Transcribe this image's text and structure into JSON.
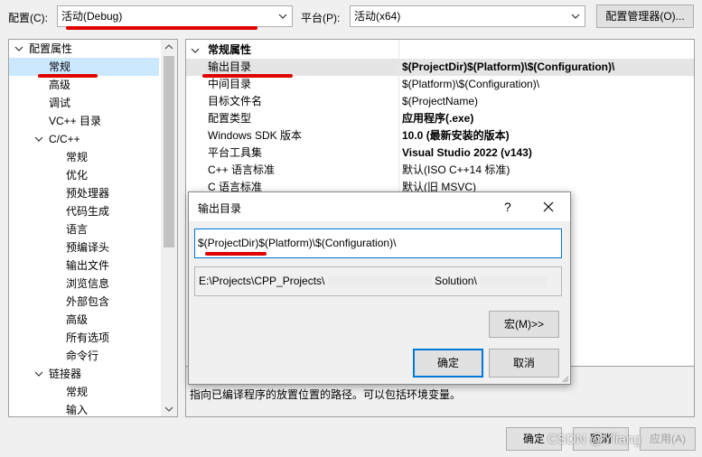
{
  "toolbar": {
    "config_label": "配置(C):",
    "config_value": "活动(Debug)",
    "platform_label": "平台(P):",
    "platform_value": "活动(x64)",
    "config_manager_label": "配置管理器(O)..."
  },
  "tree": {
    "root": "配置属性",
    "items": [
      {
        "label": "常规"
      },
      {
        "label": "高级"
      },
      {
        "label": "调试"
      },
      {
        "label": "VC++ 目录"
      },
      {
        "label": "C/C++"
      },
      {
        "label": "常规"
      },
      {
        "label": "优化"
      },
      {
        "label": "预处理器"
      },
      {
        "label": "代码生成"
      },
      {
        "label": "语言"
      },
      {
        "label": "预编译头"
      },
      {
        "label": "输出文件"
      },
      {
        "label": "浏览信息"
      },
      {
        "label": "外部包含"
      },
      {
        "label": "高级"
      },
      {
        "label": "所有选项"
      },
      {
        "label": "命令行"
      },
      {
        "label": "链接器"
      },
      {
        "label": "常规"
      },
      {
        "label": "输入"
      }
    ]
  },
  "grid": {
    "section": "常规属性",
    "rows": [
      {
        "name": "输出目录",
        "value": "$(ProjectDir)$(Platform)\\$(Configuration)\\"
      },
      {
        "name": "中间目录",
        "value": "$(Platform)\\$(Configuration)\\"
      },
      {
        "name": "目标文件名",
        "value": "$(ProjectName)"
      },
      {
        "name": "配置类型",
        "value": "应用程序(.exe)"
      },
      {
        "name": "Windows SDK 版本",
        "value": "10.0 (最新安装的版本)"
      },
      {
        "name": "平台工具集",
        "value": "Visual Studio 2022 (v143)"
      },
      {
        "name": "C++ 语言标准",
        "value": "默认(ISO C++14 标准)"
      },
      {
        "name": "C 语言标准",
        "value": "默认(旧 MSVC)"
      }
    ]
  },
  "description": "指向已编译程序的放置位置的路径。可以包括环境变量。",
  "dialog": {
    "title": "输出目录",
    "help_glyph": "?",
    "edit_value": "$(ProjectDir)$(Platform)\\$(Configuration)\\",
    "evaluated_prefix": "E:\\Projects\\CPP_Projects\\",
    "evaluated_mid": "Solution\\",
    "macro_label": "宏(M)>>",
    "ok_label": "确定",
    "cancel_label": "取消"
  },
  "footer": {
    "ok_label": "确定",
    "cancel_label": "取消",
    "apply_label": "应用(A)",
    "watermark": "CSDN @Yliang"
  },
  "colors": {
    "annotation": "#e00000",
    "selection": "#cce8ff",
    "accent_border": "#0078d7"
  }
}
